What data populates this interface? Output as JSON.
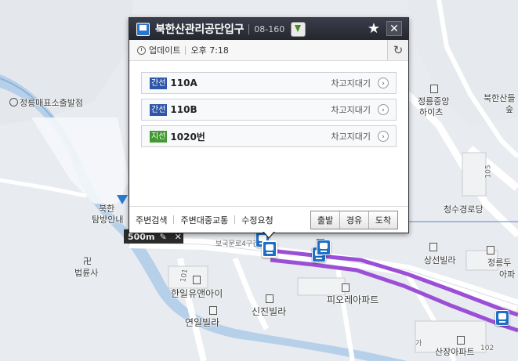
{
  "map": {
    "labels": {
      "jeongneung_mail": "정릉매표소출발점",
      "bukhansan_guide_1": "북한",
      "bukhansan_guide_2": "탐방안내",
      "beopryunsa": "법륜사",
      "jeongneung_jungang_1": "정릉중앙",
      "jeongneung_jungang_2": "하이츠",
      "bukhansan_right_1": "북한산들",
      "bukhansan_right_2": "숲",
      "cheongsu_road": "청수경로당",
      "sangseon_villa": "상선빌라",
      "jeongneung_apt_1": "정릉두",
      "jeongneung_apt_2": "아파",
      "hanil_apt": "한일유앤아이",
      "yeonil_villa": "연일빌라",
      "sinjin_villa": "신진빌라",
      "pio_apt": "피오레아파트",
      "sanjang_apt": "산장아파트",
      "road_name": "보국문로4구간",
      "num_105": "105",
      "num_101": "101",
      "num_102": "102",
      "num_ga": "가"
    },
    "scale_label": "500m",
    "route_color": "#9b4fd6"
  },
  "popup": {
    "stop_name": "북한산관리공단입구",
    "stop_id": "08-160",
    "update_label": "업데이트",
    "update_time": "오후 7:18",
    "routes": [
      {
        "type": "간선",
        "type_color": "#2e56a8",
        "name": "110A",
        "status": "차고지대기"
      },
      {
        "type": "간선",
        "type_color": "#2e56a8",
        "name": "110B",
        "status": "차고지대기"
      },
      {
        "type": "지선",
        "type_color": "#3f9a2f",
        "name": "1020번",
        "status": "차고지대기"
      }
    ],
    "footer": {
      "links": [
        "주변검색",
        "주변대중교통",
        "수정요청"
      ],
      "buttons": [
        "출발",
        "경유",
        "도착"
      ]
    }
  }
}
